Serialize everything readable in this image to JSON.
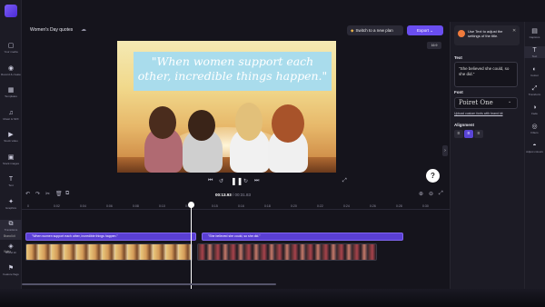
{
  "app": {
    "project_title": "Women's Day quotes",
    "upgrade_label": "Switch to a new plan",
    "export_label": "Export",
    "aspect_ratio": "16:9"
  },
  "left_rail": [
    {
      "name": "your-media",
      "label": "Your media",
      "icon": "▢"
    },
    {
      "name": "record-create",
      "label": "Record & create",
      "icon": "◉"
    },
    {
      "name": "templates",
      "label": "Templates",
      "icon": "▦"
    },
    {
      "name": "music-sfx",
      "label": "Music & SFX",
      "icon": "♫"
    },
    {
      "name": "stock-video",
      "label": "Stock video",
      "icon": "▶"
    },
    {
      "name": "stock-images",
      "label": "Stock images",
      "icon": "▣"
    },
    {
      "name": "text",
      "label": "Text",
      "icon": "T"
    },
    {
      "name": "graphics",
      "label": "Graphics",
      "icon": "✦"
    },
    {
      "name": "transitions",
      "label": "Transitions",
      "icon": "⧉"
    },
    {
      "name": "brand-kit",
      "label": "Brand kit",
      "icon": "◈"
    },
    {
      "name": "feature-flags",
      "label": "Feature flags",
      "icon": "⚑"
    }
  ],
  "preview": {
    "caption": "\"When women support each other, incredible things happen.\""
  },
  "playback": {
    "current_time": "00:13.93",
    "separator": " / ",
    "total_time": "00:31.83"
  },
  "right_panel": {
    "tip": "Use Text to adjust the settings of the title.",
    "text_label": "Text",
    "text_value": "\"She believed she could, so she did.\"",
    "font_label": "Font",
    "font_value": "Poiret One",
    "upload_link": "Upload custom fonts with brand kit",
    "alignment_label": "Alignment"
  },
  "tools": [
    {
      "name": "captions",
      "label": "Captions",
      "icon": "▤"
    },
    {
      "name": "text",
      "label": "Text",
      "icon": "T"
    },
    {
      "name": "colour",
      "label": "Colour",
      "icon": "◐"
    },
    {
      "name": "transform",
      "label": "Transform",
      "icon": "⤢"
    },
    {
      "name": "fade",
      "label": "Fade",
      "icon": "◑"
    },
    {
      "name": "filters",
      "label": "Filters",
      "icon": "◎"
    },
    {
      "name": "adjust-colours",
      "label": "Adjust colours",
      "icon": "◓"
    }
  ],
  "timeline": {
    "ticks": [
      "0",
      "0:02",
      "0:04",
      "0:06",
      "0:08",
      "0:10",
      "0:12",
      "0:15",
      "0:16",
      "0:18",
      "0:20",
      "0:22",
      "0:24",
      "0:26",
      "0:28",
      "0:30"
    ],
    "text_track_label": "Brand kit",
    "clip1_text": "\"When women support each other, incredible things happen.\"",
    "clip2_text": "\"She believed she could, so she did.\"",
    "video_track_label": "Video"
  }
}
